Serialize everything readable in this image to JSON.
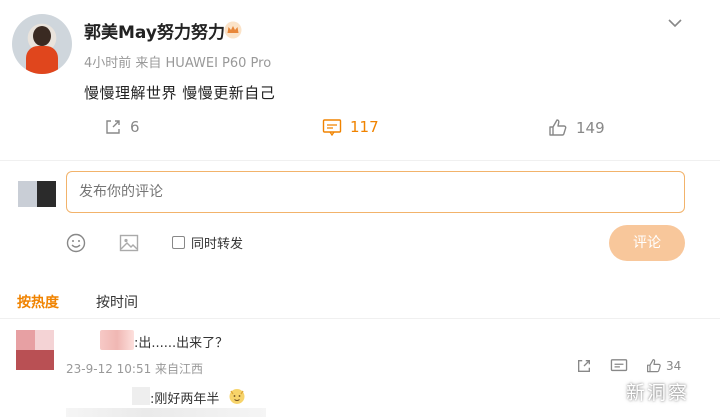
{
  "post": {
    "username": "郭美May努力努力",
    "meta": "4小时前 来自 HUAWEI P60 Pro",
    "text": "慢慢理解世界 慢慢更新自己",
    "share_count": "6",
    "comment_count": "117",
    "like_count": "149"
  },
  "compose": {
    "placeholder": "发布你的评论",
    "repost_label": "同时转发",
    "submit_label": "评论"
  },
  "sort": {
    "hot_label": "按热度",
    "time_label": "按时间"
  },
  "comments": [
    {
      "text": ":出......出来了？",
      "meta": "23-9-12 10:51 来自江西",
      "like_count": "34",
      "reply_text": ":刚好两年半"
    }
  ],
  "watermark": "新洞察",
  "colors": {
    "accent": "#f08300",
    "input_border": "#f2b36b",
    "button_disabled": "#f8c79b"
  },
  "icons": [
    "crown-icon",
    "chevron-down-icon",
    "share-icon",
    "comment-icon",
    "like-icon",
    "emoji-icon",
    "image-icon"
  ]
}
